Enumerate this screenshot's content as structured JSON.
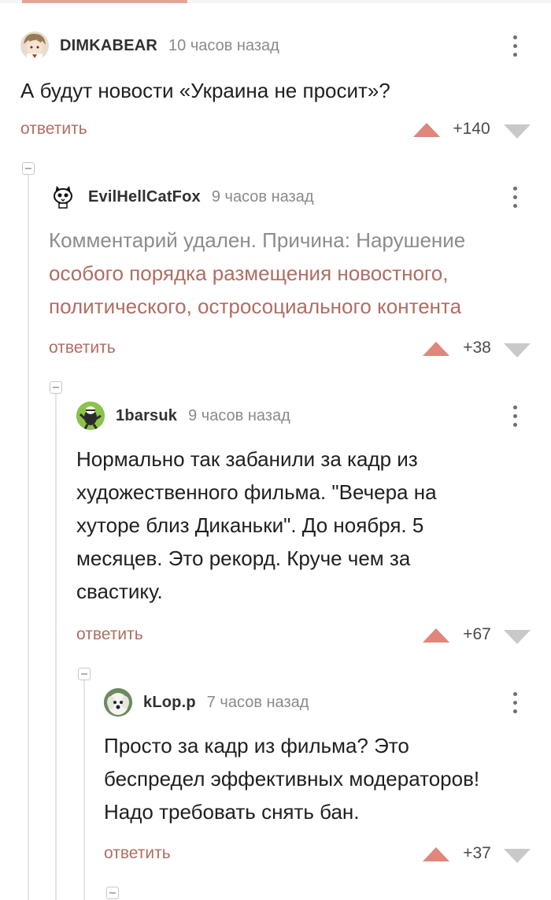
{
  "comments": [
    {
      "author": "DIMKABEAR",
      "time": "10 часов назад",
      "avatar_icon": "anime-avatar-icon",
      "text": "А будут новости «Украина не просит»?",
      "reply_label": "ответить",
      "score": "+140"
    },
    {
      "author": "EvilHellCatFox",
      "time": "9 часов назад",
      "avatar_icon": "cat-face-avatar-icon",
      "deleted_prefix": "Комментарий удален. Причина: Нарушение",
      "deleted_link_line1": "особого порядка размещения новостного,",
      "deleted_link_line2": "политического, остросоциального контента",
      "reply_label": "ответить",
      "score": "+38"
    },
    {
      "author": "1barsuk",
      "time": "9 часов назад",
      "avatar_icon": "badger-avatar-icon",
      "lines": [
        "Нормально так забанили за кадр из",
        "художественного фильма. \"Вечера на",
        "хуторе близ Диканьки\". До ноября. 5",
        "месяцев. Это рекорд. Круче чем за",
        "свастику."
      ],
      "reply_label": "ответить",
      "score": "+67"
    },
    {
      "author": "kLop.p",
      "time": "7 часов назад",
      "avatar_icon": "white-dog-avatar-icon",
      "lines": [
        "Просто за кадр из фильма? Это",
        "беспредел эффективных модераторов!",
        "Надо требовать снять бан."
      ],
      "reply_label": "ответить",
      "score": "+37"
    }
  ],
  "colors": {
    "accent": "#b06d63",
    "upvote": "#e0867a",
    "downvote": "#c9c9c9",
    "thread_line": "#e6e6e6"
  }
}
